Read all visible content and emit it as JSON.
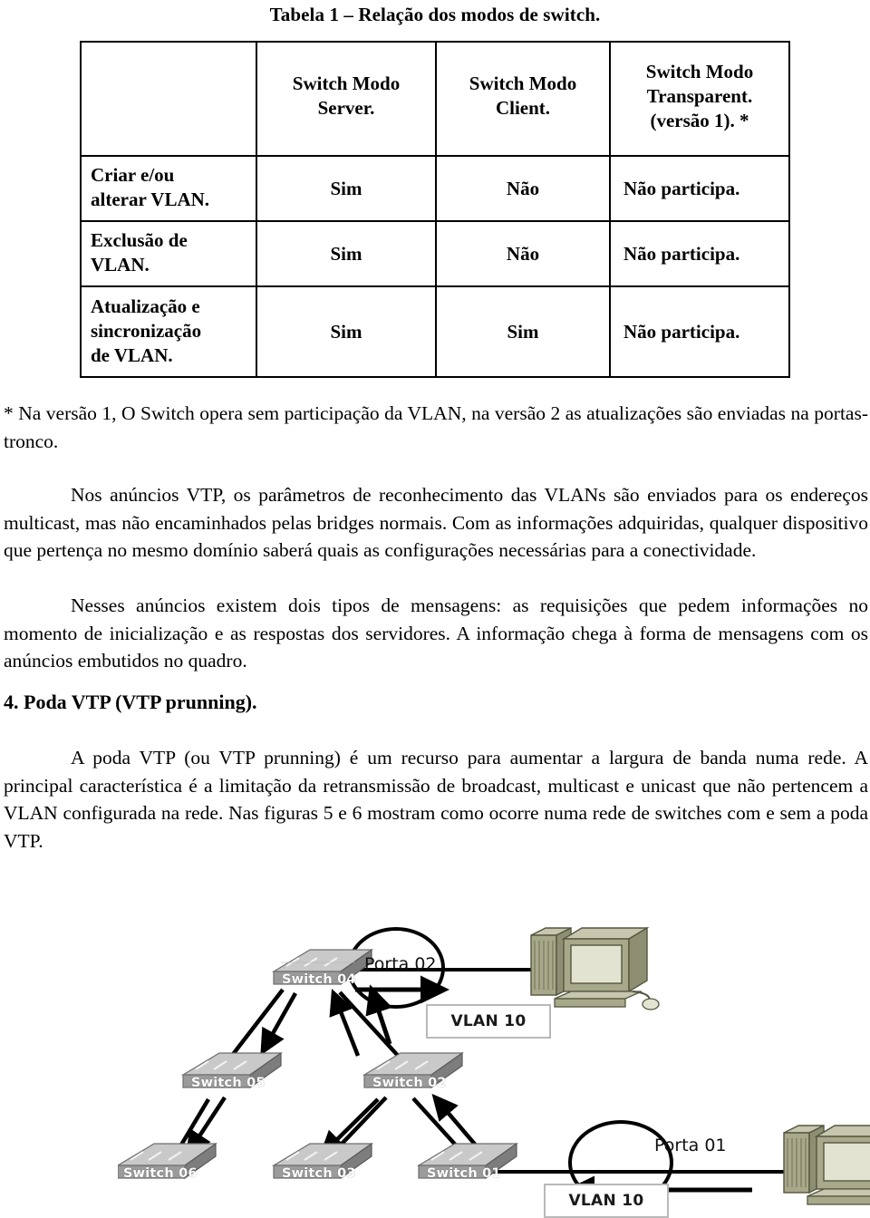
{
  "table": {
    "caption": "Tabela 1 – Relação dos modos de switch.",
    "headers": [
      "",
      "Switch Modo Server.",
      "Switch Modo Client.",
      "Switch Modo Transparent. (versão 1). *"
    ],
    "headers_lines": [
      [
        ""
      ],
      [
        "Switch Modo",
        "Server."
      ],
      [
        "Switch Modo",
        "Client."
      ],
      [
        "Switch Modo",
        "Transparent.",
        "(versão 1). *"
      ]
    ],
    "rows": [
      {
        "label_lines": [
          "Criar e/ou",
          "alterar VLAN."
        ],
        "label": "Criar e/ou alterar VLAN.",
        "server": "Sim",
        "client": "Não",
        "transparent": "Não participa."
      },
      {
        "label_lines": [
          "Exclusão de",
          "VLAN."
        ],
        "label": "Exclusão de VLAN.",
        "server": "Sim",
        "client": "Não",
        "transparent": "Não participa."
      },
      {
        "label_lines": [
          "Atualização e",
          "sincronização",
          "de VLAN."
        ],
        "label": "Atualização e sincronização de VLAN.",
        "server": "Sim",
        "client": "Sim",
        "transparent": "Não participa."
      }
    ]
  },
  "body": {
    "footnote": "* Na versão 1, O Switch opera sem participação da VLAN, na versão 2 as atualizações são enviadas na portas-tronco.",
    "paragraph_anuncios": "Nos anúncios VTP, os parâmetros de reconhecimento das VLANs são enviados para os endereços multicast, mas não encaminhados pelas bridges normais. Com as informações adquiridas, qualquer dispositivo que pertença no mesmo domínio saberá quais as configurações necessárias para a conectividade.",
    "paragraph_nesses": "Nesses anúncios existem dois tipos de mensagens: as requisições que pedem informações no momento de inicialização e as respostas dos servidores. A informação chega à forma de mensagens com os anúncios embutidos no quadro.",
    "heading_poda": "4. Poda VTP (VTP prunning).",
    "paragraph_poda": "A poda VTP (ou VTP prunning) é um recurso para aumentar a largura de banda numa rede. A principal característica é a limitação da retransmissão de broadcast, multicast e unicast que não pertencem a VLAN configurada na rede. Nas figuras 5 e 6 mostram como ocorre numa rede de switches com e sem a poda VTP."
  },
  "diagram": {
    "switches": [
      {
        "id": "switch04",
        "label": "Switch 04"
      },
      {
        "id": "switch05",
        "label": "Switch 05"
      },
      {
        "id": "switch02",
        "label": "Switch 02"
      },
      {
        "id": "switch06",
        "label": "Switch 06"
      },
      {
        "id": "switch03",
        "label": "Switch 03"
      },
      {
        "id": "switch01",
        "label": "Switch 01"
      }
    ],
    "ports": [
      {
        "id": "porta02",
        "label": "Porta 02"
      },
      {
        "id": "porta01",
        "label": "Porta 01"
      }
    ],
    "vlan_tags": [
      {
        "id": "vlan-top",
        "label": "VLAN 10"
      },
      {
        "id": "vlan-bottom",
        "label": "VLAN 10"
      }
    ],
    "hosts": [
      {
        "id": "pc-top"
      },
      {
        "id": "pc-bottom"
      }
    ],
    "colors": {
      "switch_body": "#9b9b9b",
      "switch_top": "#c9c9c9",
      "switch_side": "#7d7d7d",
      "pc_body": "#a8a98a",
      "pc_screen": "#e3e3d2",
      "line": "#000000",
      "vlan_border": "#b9b9b9"
    }
  }
}
